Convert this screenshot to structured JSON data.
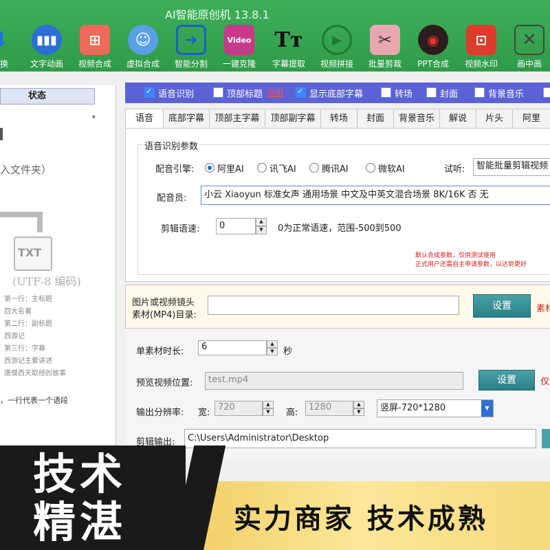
{
  "app_title": "AI智能原创机 13.8.1",
  "toolbar": [
    {
      "label": "转换",
      "icon": "arrow-down-icon"
    },
    {
      "label": "文字动画",
      "icon": "waveform-icon"
    },
    {
      "label": "视频合成",
      "icon": "grid-icon"
    },
    {
      "label": "虚拟合成",
      "icon": "avatar-icon"
    },
    {
      "label": "智能分割",
      "icon": "export-icon"
    },
    {
      "label": "一键克隆",
      "icon": "video-clone-icon"
    },
    {
      "label": "字幕提取",
      "icon": "tt-icon"
    },
    {
      "label": "视频拼接",
      "icon": "play-disc-icon"
    },
    {
      "label": "批量剪裁",
      "icon": "scissors-icon"
    },
    {
      "label": "PPT合成",
      "icon": "audio-disc-icon"
    },
    {
      "label": "视频水印",
      "icon": "watermark-icon"
    },
    {
      "label": "画中画",
      "icon": "pip-icon"
    }
  ],
  "left_panel": {
    "header": "状态",
    "hint": "入文件夹）",
    "file_label": "TXT",
    "encoding": "(UTF-8 编码)",
    "lines": [
      "第一行：主标题",
      "四大名著",
      "第二行：副标题",
      "西游记",
      "第三行：字幕",
      "西游记主要讲述",
      "唐僧西天取经的故事"
    ],
    "footer": "，一行代表一个语段"
  },
  "checkboxes": [
    {
      "label": "语音识别",
      "checked": true
    },
    {
      "label": "顶部标题",
      "checked": false
    },
    {
      "label": "说明",
      "checked": false
    },
    {
      "label": "显示底部字幕",
      "checked": true
    },
    {
      "label": "转场",
      "checked": false
    },
    {
      "label": "封面",
      "checked": false
    },
    {
      "label": "背景音乐",
      "checked": false
    }
  ],
  "tabs": [
    "语音",
    "底部字幕",
    "顶部主字幕",
    "顶部副字幕",
    "转场",
    "封面",
    "背景音乐",
    "解说",
    "片头",
    "阿里"
  ],
  "voice": {
    "group_title": "语音识别参数",
    "engine_label": "配音引擎:",
    "engines": [
      {
        "label": "阿里AI",
        "selected": true
      },
      {
        "label": "讯飞AI",
        "selected": false
      },
      {
        "label": "腾讯AI",
        "selected": false
      },
      {
        "label": "微软AI",
        "selected": false
      }
    ],
    "preview_label": "试听:",
    "preview_value": "智能批量剪辑视频",
    "voice_actor_label": "配音员:",
    "voice_actor_value": "小云 Xiaoyun 标准女声 通用场景 中文及中英文混合场景 8K/16K 否 无",
    "speed_label": "剪辑语速:",
    "speed_value": "0",
    "speed_note": "0为正常语速，范围-500到500",
    "note_line1": "默认合成参数，仅供测试使用",
    "note_line2": "正式用户还需自主申请参数，以达到更好"
  },
  "material": {
    "label_line1": "图片或视频镜头",
    "label_line2": "素材(MP4)目录:",
    "path": "",
    "button": "设置",
    "side_note": "素材"
  },
  "settings": {
    "duration_label": "单素材时长:",
    "duration_value": "6",
    "duration_unit": "秒",
    "preview_pos_label": "预览视频位置:",
    "preview_pos_value": "test.mp4",
    "preview_button": "设置",
    "preview_side_note": "仅",
    "resolution_label": "输出分辨率:",
    "width_label": "宽:",
    "width_value": "720",
    "height_label": "高:",
    "height_value": "1280",
    "orientation": "竖屏-720*1280",
    "output_label": "剪辑输出:",
    "output_path": "C:\\Users\\Administrator\\Desktop"
  },
  "banner": {
    "big_line1": "技术",
    "big_line2": "精湛",
    "slogan": "实力商家  技术成熟"
  },
  "colors": {
    "toolbar_green": "#3fae5a",
    "checkbox_bar": "#5b62d6",
    "button_teal": "#2a7f86",
    "note_red": "#d0201a",
    "banner_gold": "#f3d16a"
  }
}
